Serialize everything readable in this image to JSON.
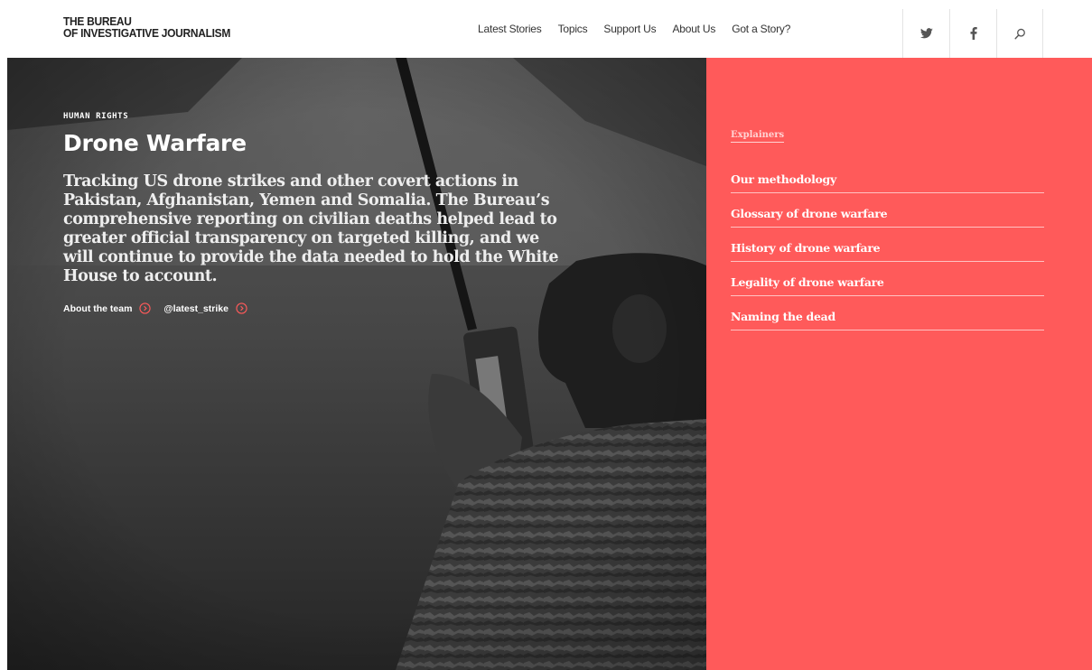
{
  "header": {
    "logo_line1": "THE BUREAU",
    "logo_line2": "OF INVESTIGATIVE JOURNALISM",
    "nav": [
      {
        "label": "Latest Stories"
      },
      {
        "label": "Topics"
      },
      {
        "label": "Support Us"
      },
      {
        "label": "About Us"
      },
      {
        "label": "Got a Story?"
      }
    ],
    "icons": [
      "twitter-icon",
      "facebook-icon",
      "search-icon"
    ]
  },
  "hero": {
    "category": "HUMAN RIGHTS",
    "title": "Drone Warfare",
    "description": "Tracking US drone strikes and other covert actions in Pakistan, Afghanistan, Yemen and Somalia. The Bureau’s comprehensive reporting on civilian deaths helped lead to greater official transparency on targeted killing, and we will continue to provide the data needed to hold the White House to account.",
    "links": [
      {
        "label": "About the team"
      },
      {
        "label": "@latest_strike"
      }
    ]
  },
  "sidebar": {
    "heading": "Explainers",
    "items": [
      {
        "label": "Our methodology"
      },
      {
        "label": "Glossary of drone warfare"
      },
      {
        "label": "History of drone warfare"
      },
      {
        "label": "Legality of drone warfare"
      },
      {
        "label": "Naming the dead"
      }
    ]
  },
  "colors": {
    "accent": "#ff5a5a",
    "header_bg": "#ffffff",
    "hero_overlay": "#2b2b2b"
  }
}
